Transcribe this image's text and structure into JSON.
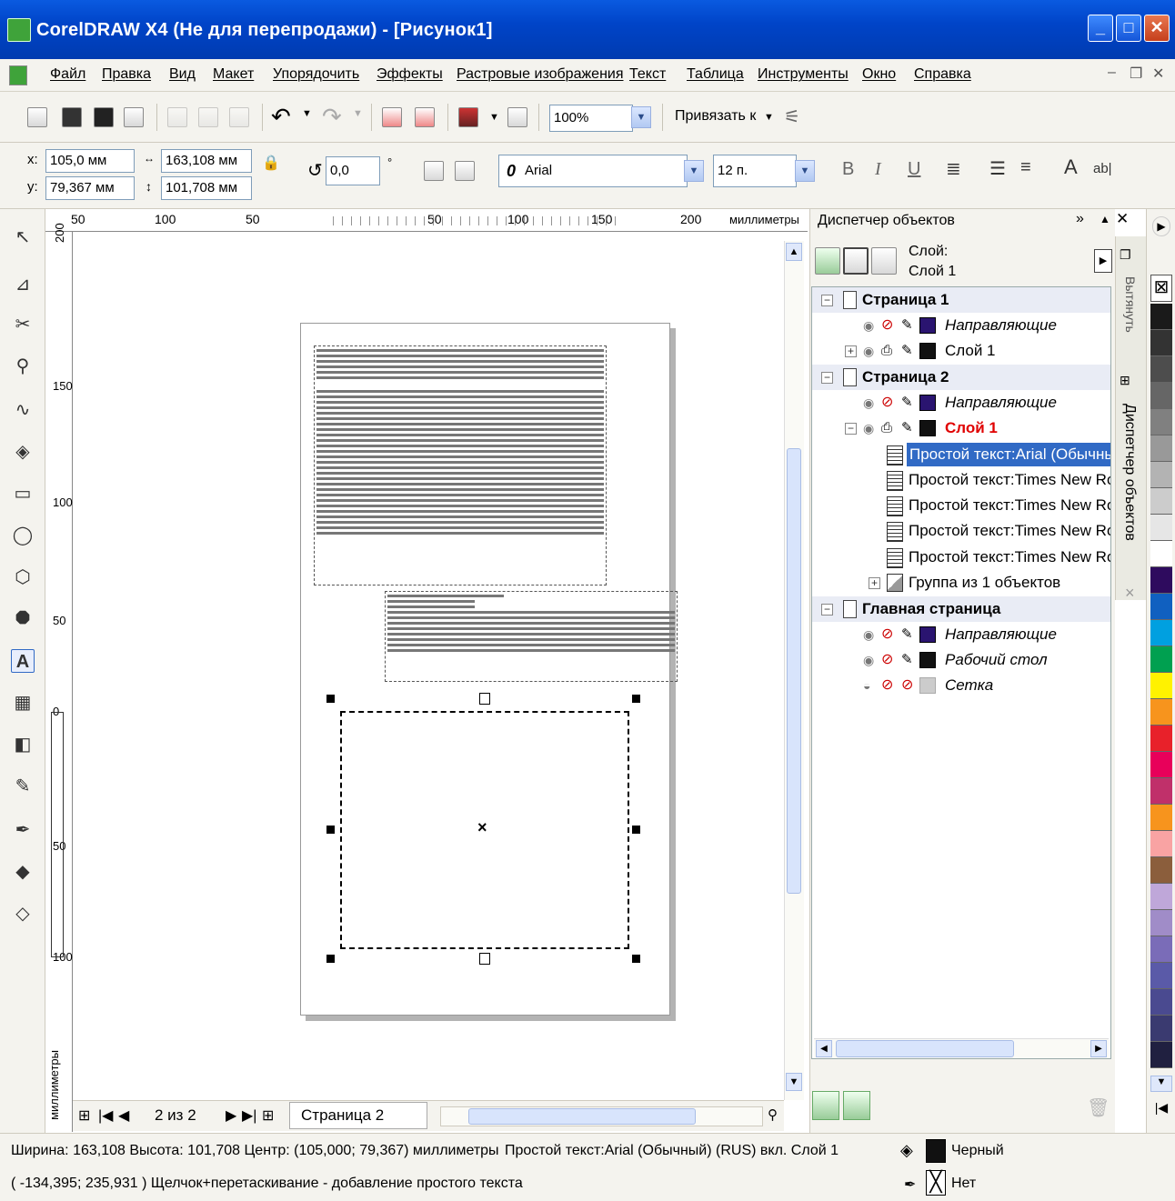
{
  "window": {
    "title": "CorelDRAW X4 (Не для перепродажи) - [Рисунок1]"
  },
  "menu": [
    "Файл",
    "Правка",
    "Вид",
    "Макет",
    "Упорядочить",
    "Эффекты",
    "Растровые изображения",
    "Текст",
    "Таблица",
    "Инструменты",
    "Окно",
    "Справка"
  ],
  "toolbar": {
    "zoom": "100%",
    "snap_label": "Привязать к"
  },
  "propbar": {
    "x": "105,0 мм",
    "y": "79,367 мм",
    "width": "163,108 мм",
    "height": "101,708 мм",
    "x_label": "x:",
    "y_label": "y:",
    "angle": "0,0",
    "deg": "°",
    "font": "Arial",
    "font_size": "12 п.",
    "bold": "B",
    "italic": "I",
    "underline": "U",
    "font_icon": "0"
  },
  "ruler": {
    "h_ticks": [
      "50",
      "100",
      "50",
      "50",
      "100",
      "150",
      "200"
    ],
    "h_unit": "миллиметры",
    "v_ticks": [
      "200",
      "150",
      "100",
      "50",
      "0",
      "50",
      "100"
    ],
    "v_unit": "миллиметры"
  },
  "docker": {
    "title": "Диспетчер объектов",
    "layer_label": "Слой:",
    "layer_value": "Слой 1",
    "rows": [
      {
        "label": "Страница 1",
        "kind": "page"
      },
      {
        "label": "Направляющие",
        "kind": "guides"
      },
      {
        "label": "Слой 1",
        "kind": "layer"
      },
      {
        "label": "Страница 2",
        "kind": "page"
      },
      {
        "label": "Направляющие",
        "kind": "guides"
      },
      {
        "label": "Слой 1",
        "kind": "layer-active"
      },
      {
        "label": "Простой текст:Arial (Обычный) (",
        "kind": "obj-selected"
      },
      {
        "label": "Простой текст:Times New Roman",
        "kind": "obj"
      },
      {
        "label": "Простой текст:Times New Roman",
        "kind": "obj"
      },
      {
        "label": "Простой текст:Times New Roman",
        "kind": "obj"
      },
      {
        "label": "Простой текст:Times New Roman",
        "kind": "obj"
      },
      {
        "label": "Группа из 1 объектов",
        "kind": "group"
      },
      {
        "label": "Главная страница",
        "kind": "page"
      },
      {
        "label": "Направляющие",
        "kind": "guides"
      },
      {
        "label": "Рабочий стол",
        "kind": "guides"
      },
      {
        "label": "Сетка",
        "kind": "grid"
      }
    ],
    "vtab_push": "Вытянуть",
    "vtab_docker": "Диспетчер объектов"
  },
  "pagenav": {
    "count": "2 из 2",
    "page_tab": "Страница 2"
  },
  "status": {
    "line1_left": "Ширина: 163,108 Высота: 101,708 Центр: (105,000; 79,367) миллиметры",
    "line1_mid": "Простой текст:Arial (Обычный) (RUS) вкл. Слой 1",
    "line2_left": "( -134,395; 235,931 )  Щелчок+перетаскивание - добавление простого текста",
    "fill_label": "Черный",
    "outline_label": "Нет"
  },
  "palette": [
    "#ffffff",
    "#1a1a1a",
    "#333333",
    "#4d4d4d",
    "#666666",
    "#808080",
    "#999999",
    "#b3b3b3",
    "#cccccc",
    "#e6e6e6",
    "#ffffff",
    "#2e0b5e",
    "#1060c0",
    "#00a0e0",
    "#00a050",
    "#fff200",
    "#f7941d",
    "#e8212a",
    "#e8005a",
    "#c0306a",
    "#f7941d",
    "#f9a3a3",
    "#8b5e3c",
    "#bfa7d9",
    "#a08cc8",
    "#7a6cb8",
    "#5a5aa8",
    "#4a4a90",
    "#3a3a70",
    "#202040"
  ],
  "colors": {
    "title_bar": "#0a5ae0",
    "selection": "#316ac5",
    "active_layer": "#e00000",
    "guides_swatch": "#2a1470"
  }
}
